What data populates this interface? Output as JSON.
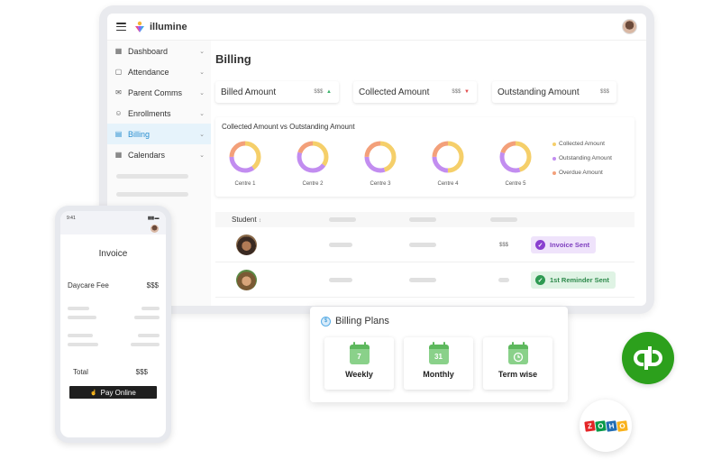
{
  "app": {
    "name": "illumine"
  },
  "sidebar": {
    "items": [
      {
        "label": "Dashboard",
        "icon": "dashboard-icon"
      },
      {
        "label": "Attendance",
        "icon": "attendance-icon"
      },
      {
        "label": "Parent Comms",
        "icon": "parent-comms-icon"
      },
      {
        "label": "Enrollments",
        "icon": "enrollments-icon"
      },
      {
        "label": "Billing",
        "icon": "billing-icon",
        "active": true
      },
      {
        "label": "Calendars",
        "icon": "calendar-icon"
      }
    ]
  },
  "page": {
    "title": "Billing"
  },
  "stats": [
    {
      "label": "Billed Amount",
      "value": "$$$",
      "trend": "up"
    },
    {
      "label": "Collected Amount",
      "value": "$$$",
      "trend": "down"
    },
    {
      "label": "Outstanding Amount",
      "value": "$$$"
    }
  ],
  "chart_data": {
    "type": "pie",
    "title": "Collected Amount vs Outstanding Amount",
    "categories": [
      "Centre 1",
      "Centre 2",
      "Centre 3",
      "Centre 4",
      "Centre 5"
    ],
    "series": [
      {
        "name": "Collected Amount",
        "color": "#f5cf6a",
        "values": [
          40,
          35,
          45,
          50,
          45
        ]
      },
      {
        "name": "Outstanding Amount",
        "color": "#c28df0",
        "values": [
          35,
          45,
          30,
          25,
          35
        ]
      },
      {
        "name": "Overdue Amount",
        "color": "#f3a07a",
        "values": [
          25,
          20,
          25,
          25,
          20
        ]
      }
    ],
    "legend": "right"
  },
  "table": {
    "header": {
      "student": "Student",
      "sort_icon": "↕"
    },
    "rows": [
      {
        "amount": "$$$",
        "status": "Invoice Sent",
        "status_icon": "check-circle-icon",
        "status_color": "#7f3fbf"
      },
      {
        "amount": "",
        "status": "1st Reminder Sent",
        "status_icon": "check-circle-icon",
        "status_color": "#2e8a4c"
      }
    ]
  },
  "phone": {
    "time": "9:41",
    "title": "Invoice",
    "fee_label": "Daycare Fee",
    "fee_value": "$$$",
    "total_label": "Total",
    "total_value": "$$$",
    "pay_button": "Pay Online"
  },
  "plans": {
    "title": "Billing Plans",
    "items": [
      {
        "label": "Weekly",
        "day": "7",
        "icon": "calendar-week-icon"
      },
      {
        "label": "Monthly",
        "day": "31",
        "icon": "calendar-month-icon"
      },
      {
        "label": "Term wise",
        "day": "",
        "icon": "calendar-clock-icon"
      }
    ]
  },
  "integrations": {
    "quickbooks": {
      "logo": "qb",
      "color": "#2ca01c"
    },
    "zoho": {
      "letters": [
        "Z",
        "O",
        "H",
        "O"
      ],
      "colors": [
        "#e42527",
        "#089949",
        "#226db4",
        "#f9b21d"
      ]
    }
  }
}
